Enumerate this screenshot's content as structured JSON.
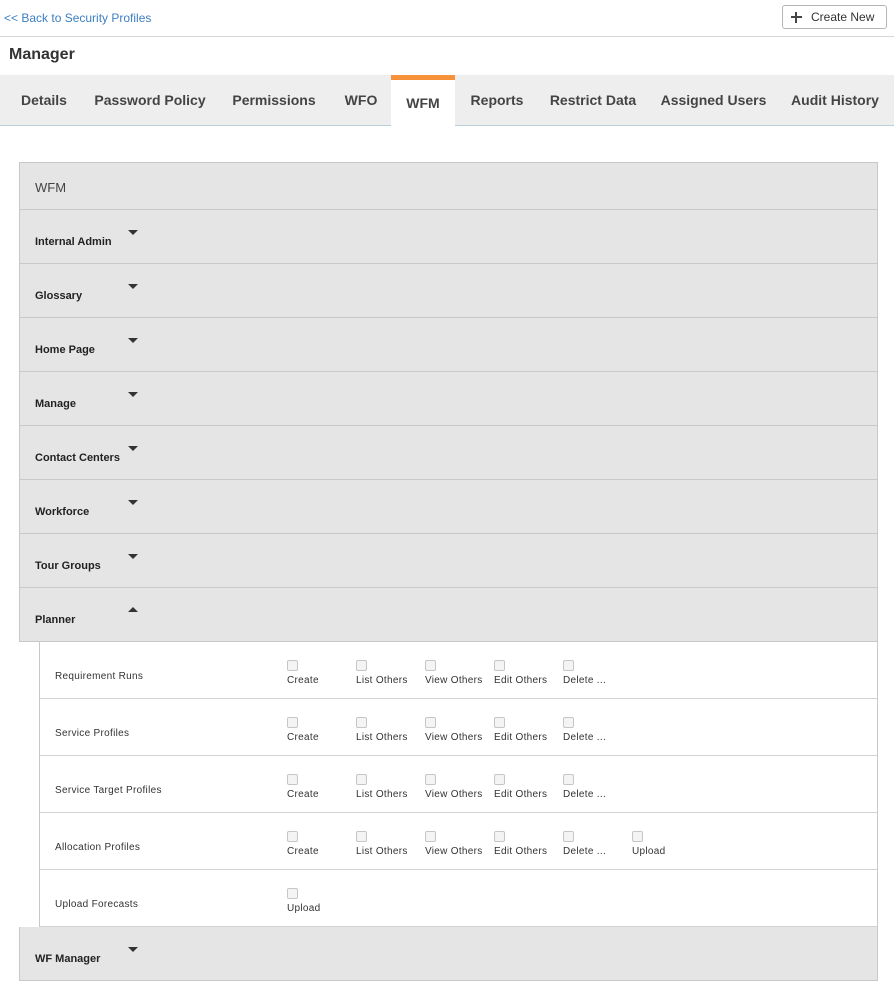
{
  "nav": {
    "back_label": "<< Back to Security Profiles",
    "create_label": "Create New"
  },
  "page": {
    "title": "Manager"
  },
  "tabs": [
    {
      "label": "Details"
    },
    {
      "label": "Password Policy"
    },
    {
      "label": "Permissions"
    },
    {
      "label": "WFO"
    },
    {
      "label": "WFM",
      "active": true
    },
    {
      "label": "Reports"
    },
    {
      "label": "Restrict Data"
    },
    {
      "label": "Assigned Users"
    },
    {
      "label": "Audit History"
    }
  ],
  "panel": {
    "header": "WFM",
    "sections": [
      {
        "label": "Internal Admin",
        "expanded": false
      },
      {
        "label": "Glossary",
        "expanded": false
      },
      {
        "label": "Home Page",
        "expanded": false
      },
      {
        "label": "Manage",
        "expanded": false
      },
      {
        "label": "Contact Centers",
        "expanded": false
      },
      {
        "label": "Workforce",
        "expanded": false
      },
      {
        "label": "Tour Groups",
        "expanded": false
      },
      {
        "label": "Planner",
        "expanded": true
      }
    ],
    "planner_rows": [
      {
        "label": "Requirement Runs",
        "perms": [
          "Create",
          "List Others",
          "View Others",
          "Edit Others",
          "Delete ..."
        ]
      },
      {
        "label": "Service Profiles",
        "perms": [
          "Create",
          "List Others",
          "View Others",
          "Edit Others",
          "Delete ..."
        ]
      },
      {
        "label": "Service Target Profiles",
        "perms": [
          "Create",
          "List Others",
          "View Others",
          "Edit Others",
          "Delete ..."
        ]
      },
      {
        "label": "Allocation Profiles",
        "perms": [
          "Create",
          "List Others",
          "View Others",
          "Edit Others",
          "Delete ...",
          "Upload"
        ]
      },
      {
        "label": "Upload Forecasts",
        "perms": [
          "Upload"
        ]
      }
    ],
    "after_section": {
      "label": "WF Manager",
      "expanded": false
    }
  },
  "colors": {
    "link": "#3d7fc2",
    "active_tab_accent": "#f7923a",
    "section_bg": "#e5e5e5",
    "tabbar_bg": "#eeeeee"
  }
}
